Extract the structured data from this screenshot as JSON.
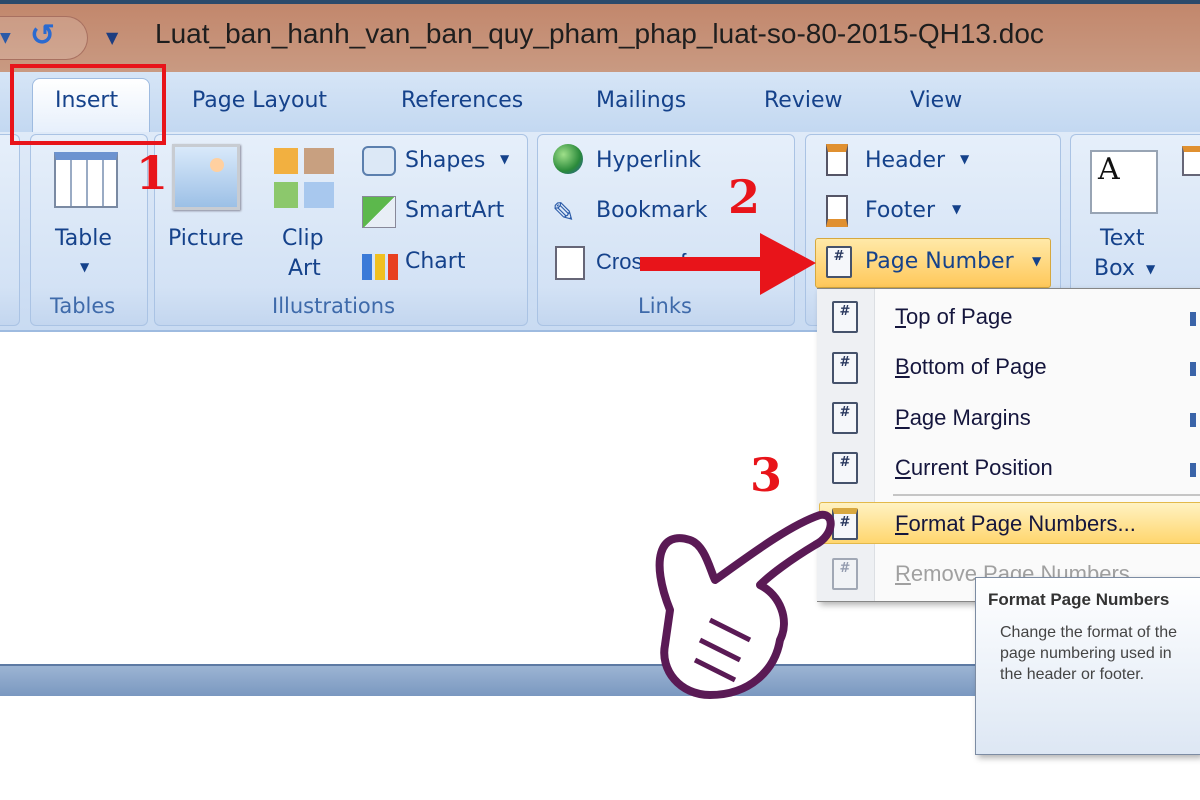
{
  "window": {
    "title": "Luat_ban_hanh_van_ban_quy_pham_phap_luat-so-80-2015-QH13.doc"
  },
  "tabs": [
    "Insert",
    "Page Layout",
    "References",
    "Mailings",
    "Review",
    "View"
  ],
  "ribbon": {
    "tables": {
      "label": "Tables",
      "table": "Table"
    },
    "illustrations": {
      "label": "Illustrations",
      "picture": "Picture",
      "clip1": "Clip",
      "clip2": "Art",
      "shapes": "Shapes",
      "smartart": "SmartArt",
      "chart": "Chart"
    },
    "links": {
      "label": "Links",
      "hyperlink": "Hyperlink",
      "bookmark": "Bookmark",
      "crossref": "Cross-reference"
    },
    "header_footer": {
      "header": "Header",
      "footer": "Footer",
      "page_number": "Page Number"
    },
    "text": {
      "textbox1": "Text",
      "textbox2": "Box"
    }
  },
  "menu": {
    "items": [
      {
        "key": "T",
        "rest": "op of Page",
        "submenu": true
      },
      {
        "key": "B",
        "rest": "ottom of Page",
        "submenu": true
      },
      {
        "key": "P",
        "rest": "age Margins",
        "submenu": true
      },
      {
        "key": "C",
        "rest": "urrent Position",
        "submenu": true
      },
      {
        "key": "F",
        "rest": "ormat Page Numbers...",
        "highlighted": true
      },
      {
        "key": "R",
        "rest": "emove Page Numbers",
        "disabled": true
      }
    ]
  },
  "tooltip": {
    "title": "Format Page Numbers",
    "lines": [
      "Change the format of the page",
      "numbering used in the header or",
      "footer."
    ]
  },
  "annotations": {
    "step1": "1",
    "step2": "2",
    "step3": "3",
    "color": "#e8141a"
  },
  "colors": {
    "titlebar": "#c2876c",
    "ribbon": "#d6e5f6",
    "text": "#15428b",
    "highlight": "#ffd66e"
  }
}
